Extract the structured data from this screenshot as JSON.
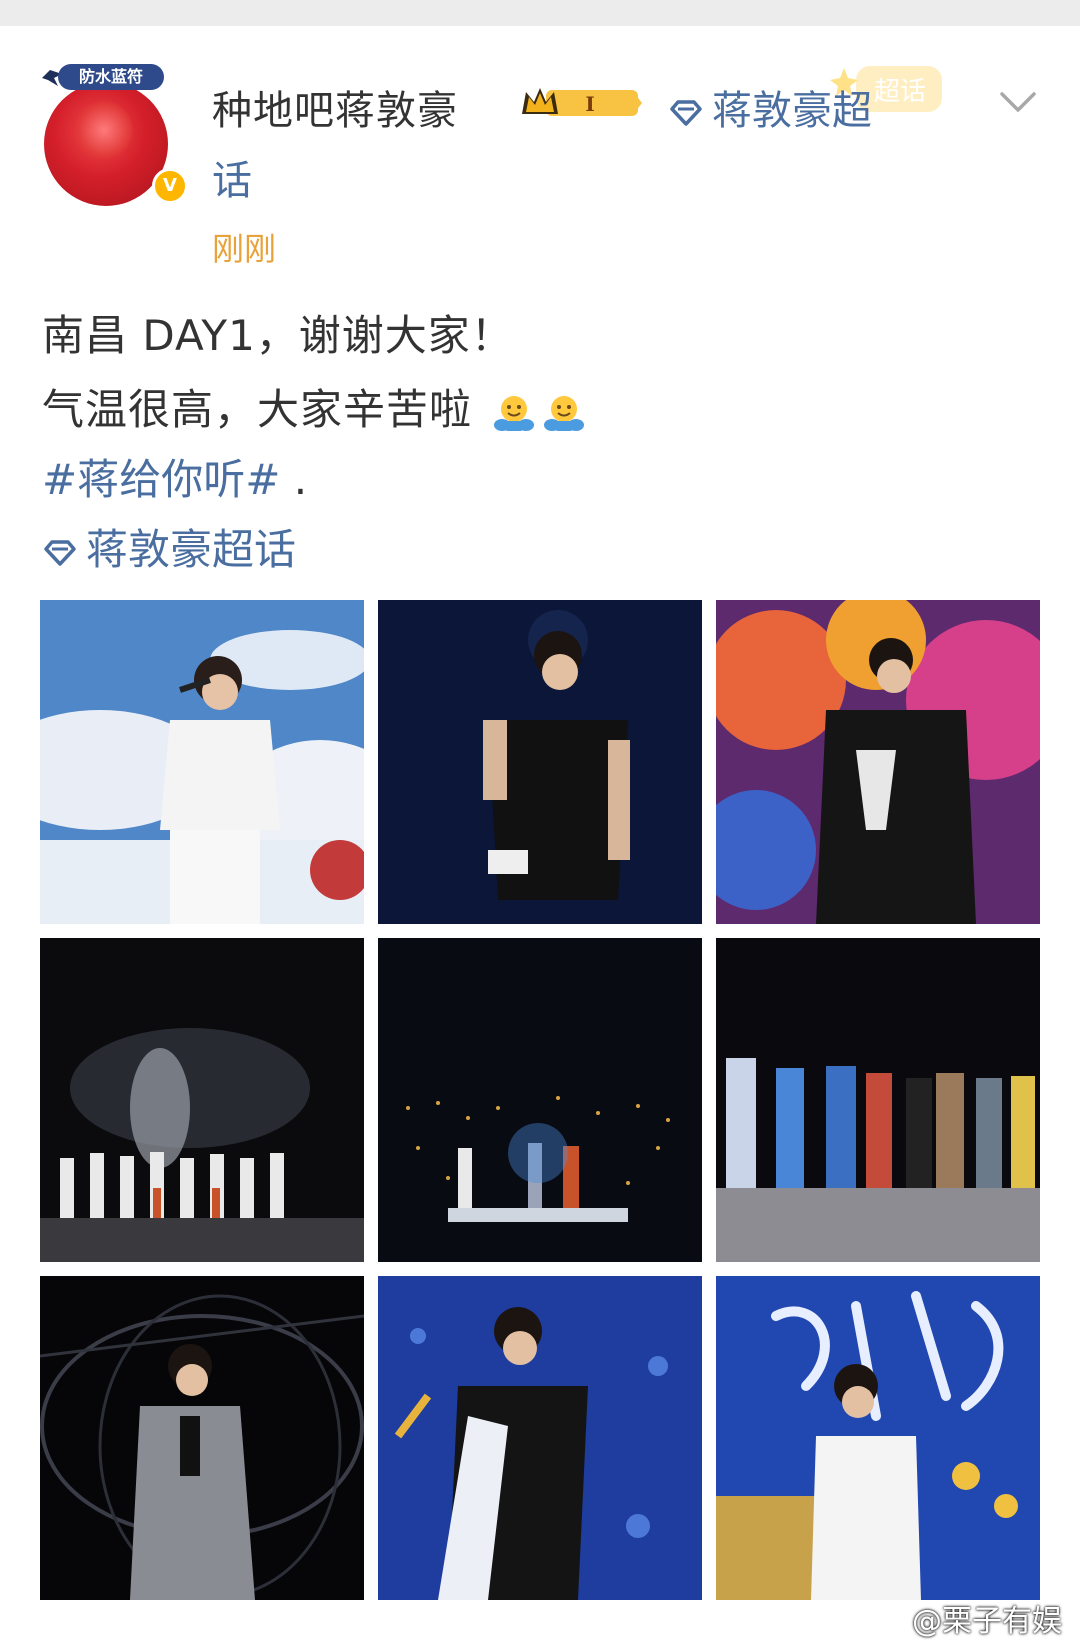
{
  "post": {
    "author": {
      "name": "种地吧蒋敦豪",
      "avatar_badge_text": "防水蓝符",
      "verified_mark": "V",
      "level_badge": "I"
    },
    "supertopic_tag_part1": "蒋敦豪超",
    "supertopic_tag_part2": "话",
    "timestamp": "刚刚",
    "text_line1": "南昌 DAY1，谢谢大家！",
    "text_line2": "气温很高，大家辛苦啦",
    "hashtag": "#蒋给你听#",
    "hashtag_trailing": " .",
    "supertopic_link": "蒋敦豪超话",
    "supertopic_sticker": "超话"
  },
  "photos": [
    {
      "label": "singer-white-jacket-sky",
      "bg": "#4e86c8"
    },
    {
      "label": "singer-black-vest",
      "bg": "#0d1a3a"
    },
    {
      "label": "singer-black-jacket-colorful",
      "bg": "#c24a3a"
    },
    {
      "label": "group-bow-smoke",
      "bg": "#0b0b0d"
    },
    {
      "label": "stage-lift-lights",
      "bg": "#0a0c14"
    },
    {
      "label": "group-stage-back",
      "bg": "#0b0b10"
    },
    {
      "label": "singer-sparkle-suit",
      "bg": "#060608"
    },
    {
      "label": "singer-blue-lights",
      "bg": "#1e3d9e"
    },
    {
      "label": "singer-white-calligraphy",
      "bg": "#2148b0"
    }
  ],
  "watermark": "@栗子有娱",
  "colors": {
    "link": "#4a6ea0",
    "timestamp": "#e8a23a",
    "text": "#333333"
  }
}
